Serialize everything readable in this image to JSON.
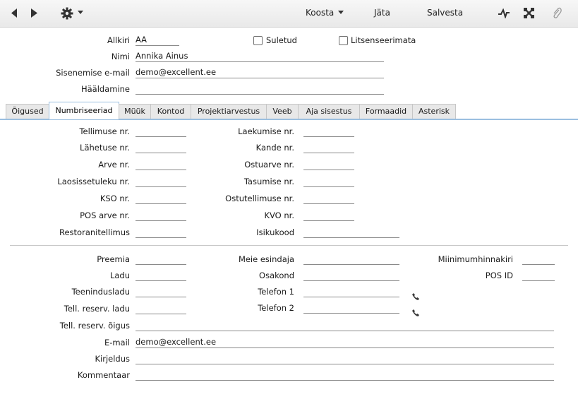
{
  "toolbar": {
    "koosta": "Koosta",
    "jata": "Jäta",
    "salvesta": "Salvesta"
  },
  "header": {
    "allkiri_label": "Allkiri",
    "allkiri_value": "AA",
    "suletud_label": "Suletud",
    "litsenseerimata_label": "Litsenseerimata",
    "nimi_label": "Nimi",
    "nimi_value": "Annika Ainus",
    "email_label": "Sisenemise e-mail",
    "email_value": "demo@excellent.ee",
    "haaldamine_label": "Hääldamine"
  },
  "tabs": [
    "Õigused",
    "Numbriseeriad",
    "Müük",
    "Kontod",
    "Projektiarvestus",
    "Veeb",
    "Aja sisestus",
    "Formaadid",
    "Asterisk"
  ],
  "number_series": {
    "left": [
      "Tellimuse nr.",
      "Lähetuse nr.",
      "Arve nr.",
      "Laosissetuleku nr.",
      "KSO nr.",
      "POS arve nr.",
      "Restoranitellimus"
    ],
    "right": [
      "Laekumise nr.",
      "Kande nr.",
      "Ostuarve nr.",
      "Tasumise nr.",
      "Ostutellimuse nr.",
      "KVO nr.",
      "Isikukood"
    ]
  },
  "details": {
    "preemia": "Preemia",
    "ladu": "Ladu",
    "teeninduladu": "Teenindusladu",
    "tell_reserv_ladu": "Tell. reserv. ladu",
    "tell_reserv_oigus": "Tell. reserv. õigus",
    "email_label": "E-mail",
    "email_value": "demo@excellent.ee",
    "kirjeldus": "Kirjeldus",
    "kommentaar": "Kommentaar",
    "meie_esindaja": "Meie esindaja",
    "osakond": "Osakond",
    "telefon1": "Telefon 1",
    "telefon2": "Telefon 2",
    "miinimumhinnakiri": "Miinimumhinnakiri",
    "pos_id": "POS ID"
  }
}
